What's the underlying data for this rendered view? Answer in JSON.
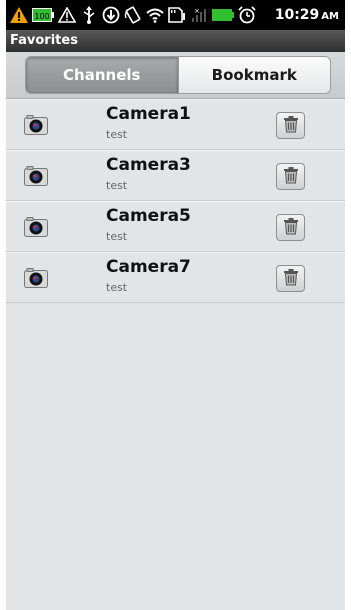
{
  "status_bar": {
    "time": "10:29",
    "ampm": "AM",
    "battery_label": "100",
    "icons": [
      "warning-icon",
      "battery-100-icon",
      "alert-triangle-icon",
      "usb-icon",
      "download-icon",
      "rotate-icon",
      "wifi-icon",
      "sd-card-icon",
      "signal-icon",
      "battery-icon",
      "alarm-icon"
    ]
  },
  "title_bar": {
    "title": "Favorites"
  },
  "tabs": [
    {
      "label": "Channels",
      "active": true
    },
    {
      "label": "Bookmark",
      "active": false
    }
  ],
  "favorites": [
    {
      "name": "Camera1",
      "subtitle": "test"
    },
    {
      "name": "Camera3",
      "subtitle": "test"
    },
    {
      "name": "Camera5",
      "subtitle": "test"
    },
    {
      "name": "Camera7",
      "subtitle": "test"
    }
  ],
  "colors": {
    "status_bar": "#000000",
    "title_bar": "#3a3a3a",
    "list_background": "#e2e4e6",
    "battery_green": "#2fbf2f",
    "warning_orange": "#f0a000"
  }
}
